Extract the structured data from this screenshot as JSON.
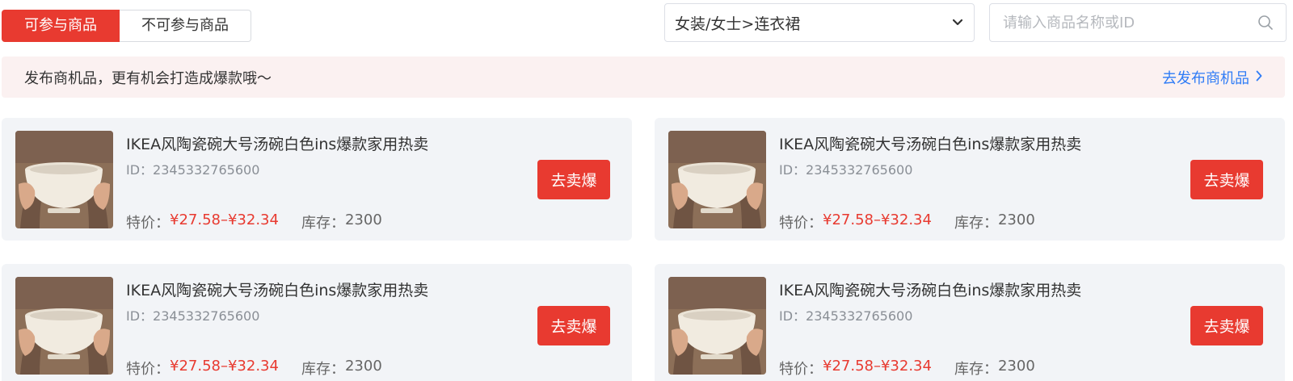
{
  "tabs": [
    {
      "label": "可参与商品",
      "active": true
    },
    {
      "label": "不可参与商品",
      "active": false
    }
  ],
  "category_select": {
    "value": "女装/女士>连衣裙",
    "icon": "chevron-down-icon"
  },
  "search": {
    "placeholder": "请输入商品名称或ID",
    "value": "",
    "icon": "search-icon"
  },
  "banner": {
    "message": "发布商机品，更有机会打造成爆款哦～",
    "link_label": "去发布商机品",
    "link_icon": "chevron-right-icon"
  },
  "products": [
    {
      "title": "IKEA风陶瓷碗大号汤碗白色ins爆款家用热卖",
      "id_label": "ID：",
      "id": "2345332765600",
      "price_label": "特价：",
      "price": "¥27.58–¥32.34",
      "stock_label": "库存：",
      "stock": "2300",
      "button_label": "去卖爆"
    },
    {
      "title": "IKEA风陶瓷碗大号汤碗白色ins爆款家用热卖",
      "id_label": "ID：",
      "id": "2345332765600",
      "price_label": "特价：",
      "price": "¥27.58–¥32.34",
      "stock_label": "库存：",
      "stock": "2300",
      "button_label": "去卖爆"
    },
    {
      "title": "IKEA风陶瓷碗大号汤碗白色ins爆款家用热卖",
      "id_label": "ID：",
      "id": "2345332765600",
      "price_label": "特价：",
      "price": "¥27.58–¥32.34",
      "stock_label": "库存：",
      "stock": "2300",
      "button_label": "去卖爆"
    },
    {
      "title": "IKEA风陶瓷碗大号汤碗白色ins爆款家用热卖",
      "id_label": "ID：",
      "id": "2345332765600",
      "price_label": "特价：",
      "price": "¥27.58–¥32.34",
      "stock_label": "库存：",
      "stock": "2300",
      "button_label": "去卖爆"
    }
  ],
  "colors": {
    "accent": "#e83a30",
    "link": "#2f7cf6",
    "banner_bg": "#fbf1f1",
    "card_bg": "#f2f4f7"
  }
}
